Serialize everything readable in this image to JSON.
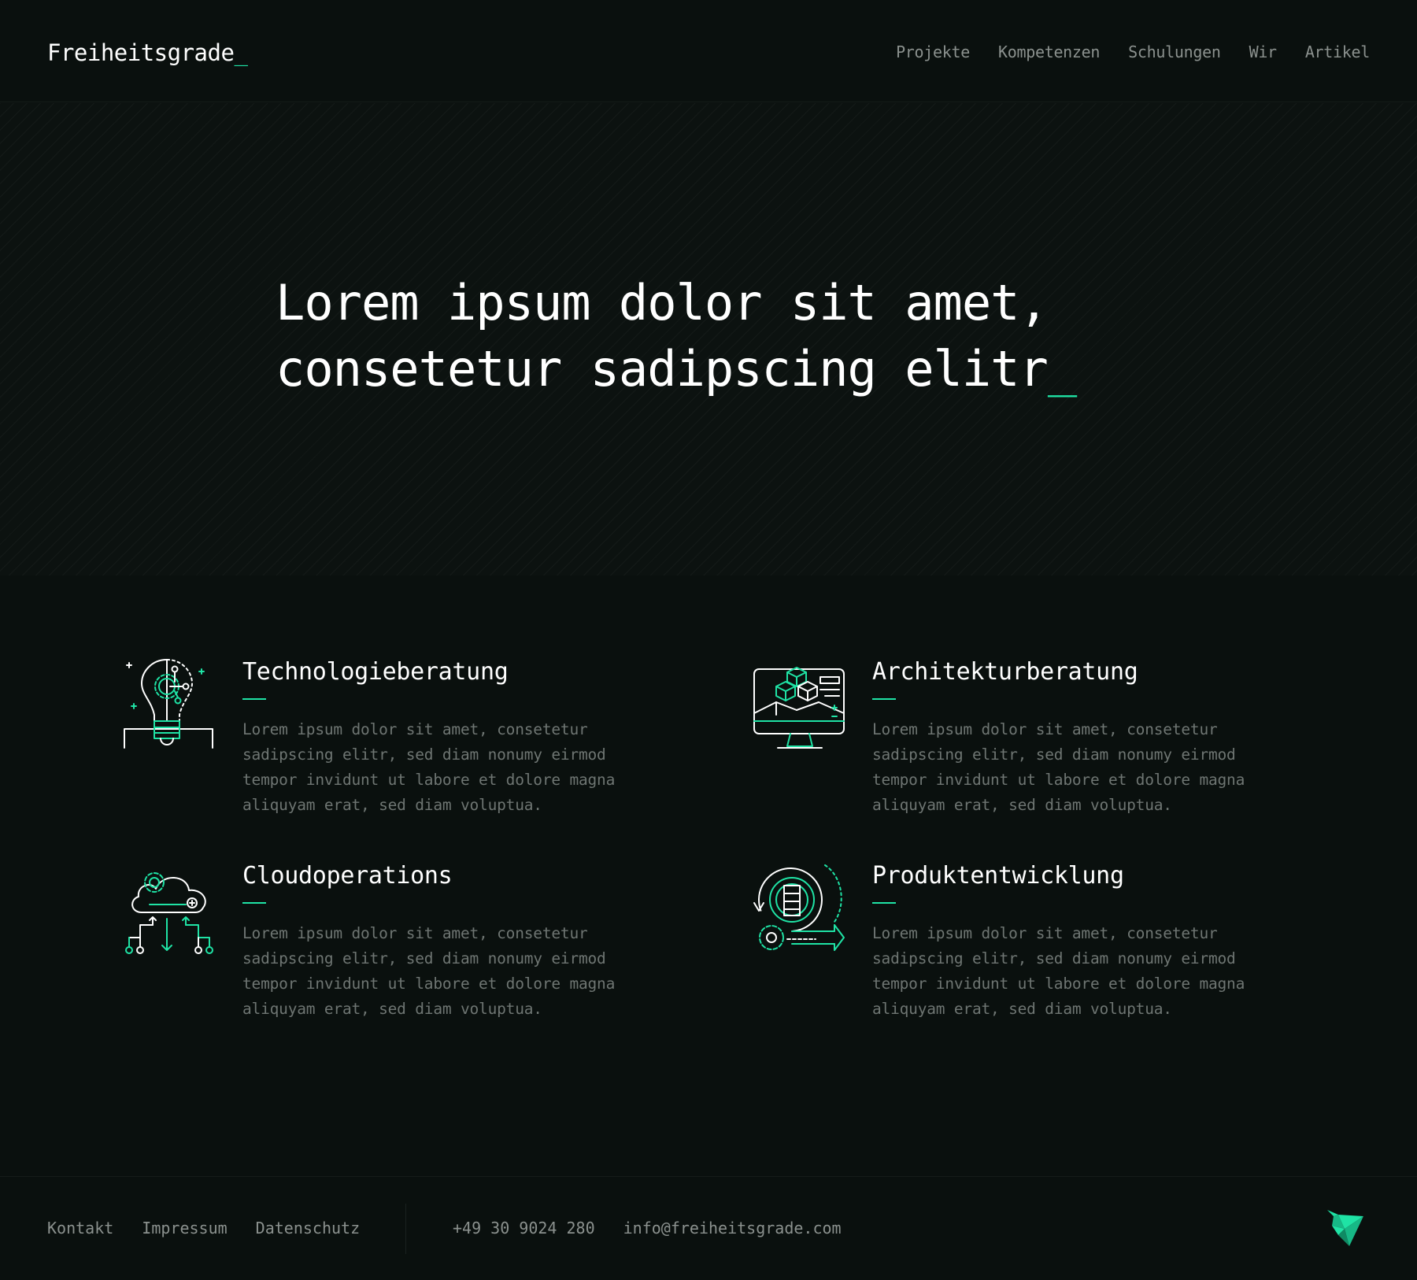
{
  "header": {
    "logo_text": "Freiheitsgrade",
    "logo_cursor": "_",
    "nav": [
      "Projekte",
      "Kompetenzen",
      "Schulungen",
      "Wir",
      "Artikel"
    ]
  },
  "hero": {
    "line1": "Lorem ipsum dolor sit amet,",
    "line2": "consetetur sadipscing elitr",
    "cursor": "_"
  },
  "services": [
    {
      "title": "Technologieberatung",
      "icon": "lightbulb-circuit-icon",
      "description": "Lorem ipsum dolor sit amet, consetetur sadipscing elitr, sed diam nonumy eirmod tempor invidunt ut labore et dolore magna aliquyam erat, sed diam voluptua."
    },
    {
      "title": "Architekturberatung",
      "icon": "monitor-cubes-icon",
      "description": "Lorem ipsum dolor sit amet, consetetur sadipscing elitr, sed diam nonumy eirmod tempor invidunt ut labore et dolore magna aliquyam erat, sed diam voluptua."
    },
    {
      "title": "Cloudoperations",
      "icon": "cloud-gear-icon",
      "description": "Lorem ipsum dolor sit amet, consetetur sadipscing elitr, sed diam nonumy eirmod tempor invidunt ut labore et dolore magna aliquyam erat, sed diam voluptua."
    },
    {
      "title": "Produktentwicklung",
      "icon": "product-cycle-icon",
      "description": "Lorem ipsum dolor sit amet, consetetur sadipscing elitr, sed diam nonumy eirmod tempor invidunt ut labore et dolore magna aliquyam erat, sed diam voluptua."
    }
  ],
  "footer": {
    "links": [
      "Kontakt",
      "Impressum",
      "Datenschutz"
    ],
    "phone": "+49 30 9024 280",
    "email": "info@freiheitsgrade.com",
    "brand_icon": "bird-logo-icon"
  },
  "colors": {
    "background": "#0a100e",
    "accent": "#1fe3a5",
    "text": "#ffffff",
    "muted": "#6e7572",
    "nav": "#8b918e"
  }
}
